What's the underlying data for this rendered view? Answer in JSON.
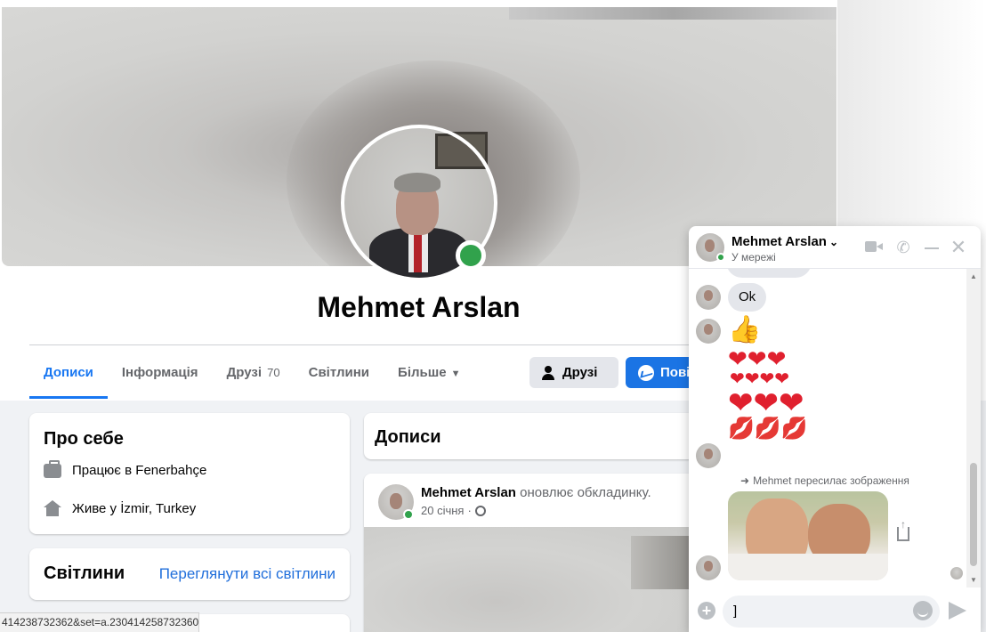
{
  "profile": {
    "name": "Mehmet Arslan"
  },
  "tabs": [
    {
      "label": "Дописи"
    },
    {
      "label": "Інформація"
    },
    {
      "label": "Друзі",
      "count": "70"
    },
    {
      "label": "Світлини"
    },
    {
      "label": "Більше"
    }
  ],
  "actions": {
    "friends_label": "Друзі",
    "message_label": "Повід"
  },
  "about": {
    "title": "Про себе",
    "work_prefix": "Працює в",
    "work_place": "Fenerbahçe",
    "lives_prefix": "Живе у",
    "lives_place": "İzmir, Turkey"
  },
  "photos": {
    "title": "Світлини",
    "see_all": "Переглянути всі світлини"
  },
  "posts": {
    "title": "Дописи",
    "post_author": "Mehmet Arslan",
    "post_action": "оновлює обкладинку.",
    "post_date": "20 січня"
  },
  "statusbar": {
    "url": "414238732362&set=a.230414258732360"
  },
  "chat": {
    "name": "Mehmet Arslan",
    "status": "У мережі",
    "messages": {
      "ok": "Ok",
      "like": "👍",
      "hearts_row1": "❤❤❤",
      "hearts_row2": "❤❤❤❤",
      "hearts_row3": "❤❤❤",
      "lips_row": "💋💋💋",
      "forward_note": "Mehmet пересилає зображення"
    },
    "input_value": "]"
  },
  "colors": {
    "accent": "#1877f2",
    "online": "#31a24c",
    "heart": "#e0202e"
  }
}
